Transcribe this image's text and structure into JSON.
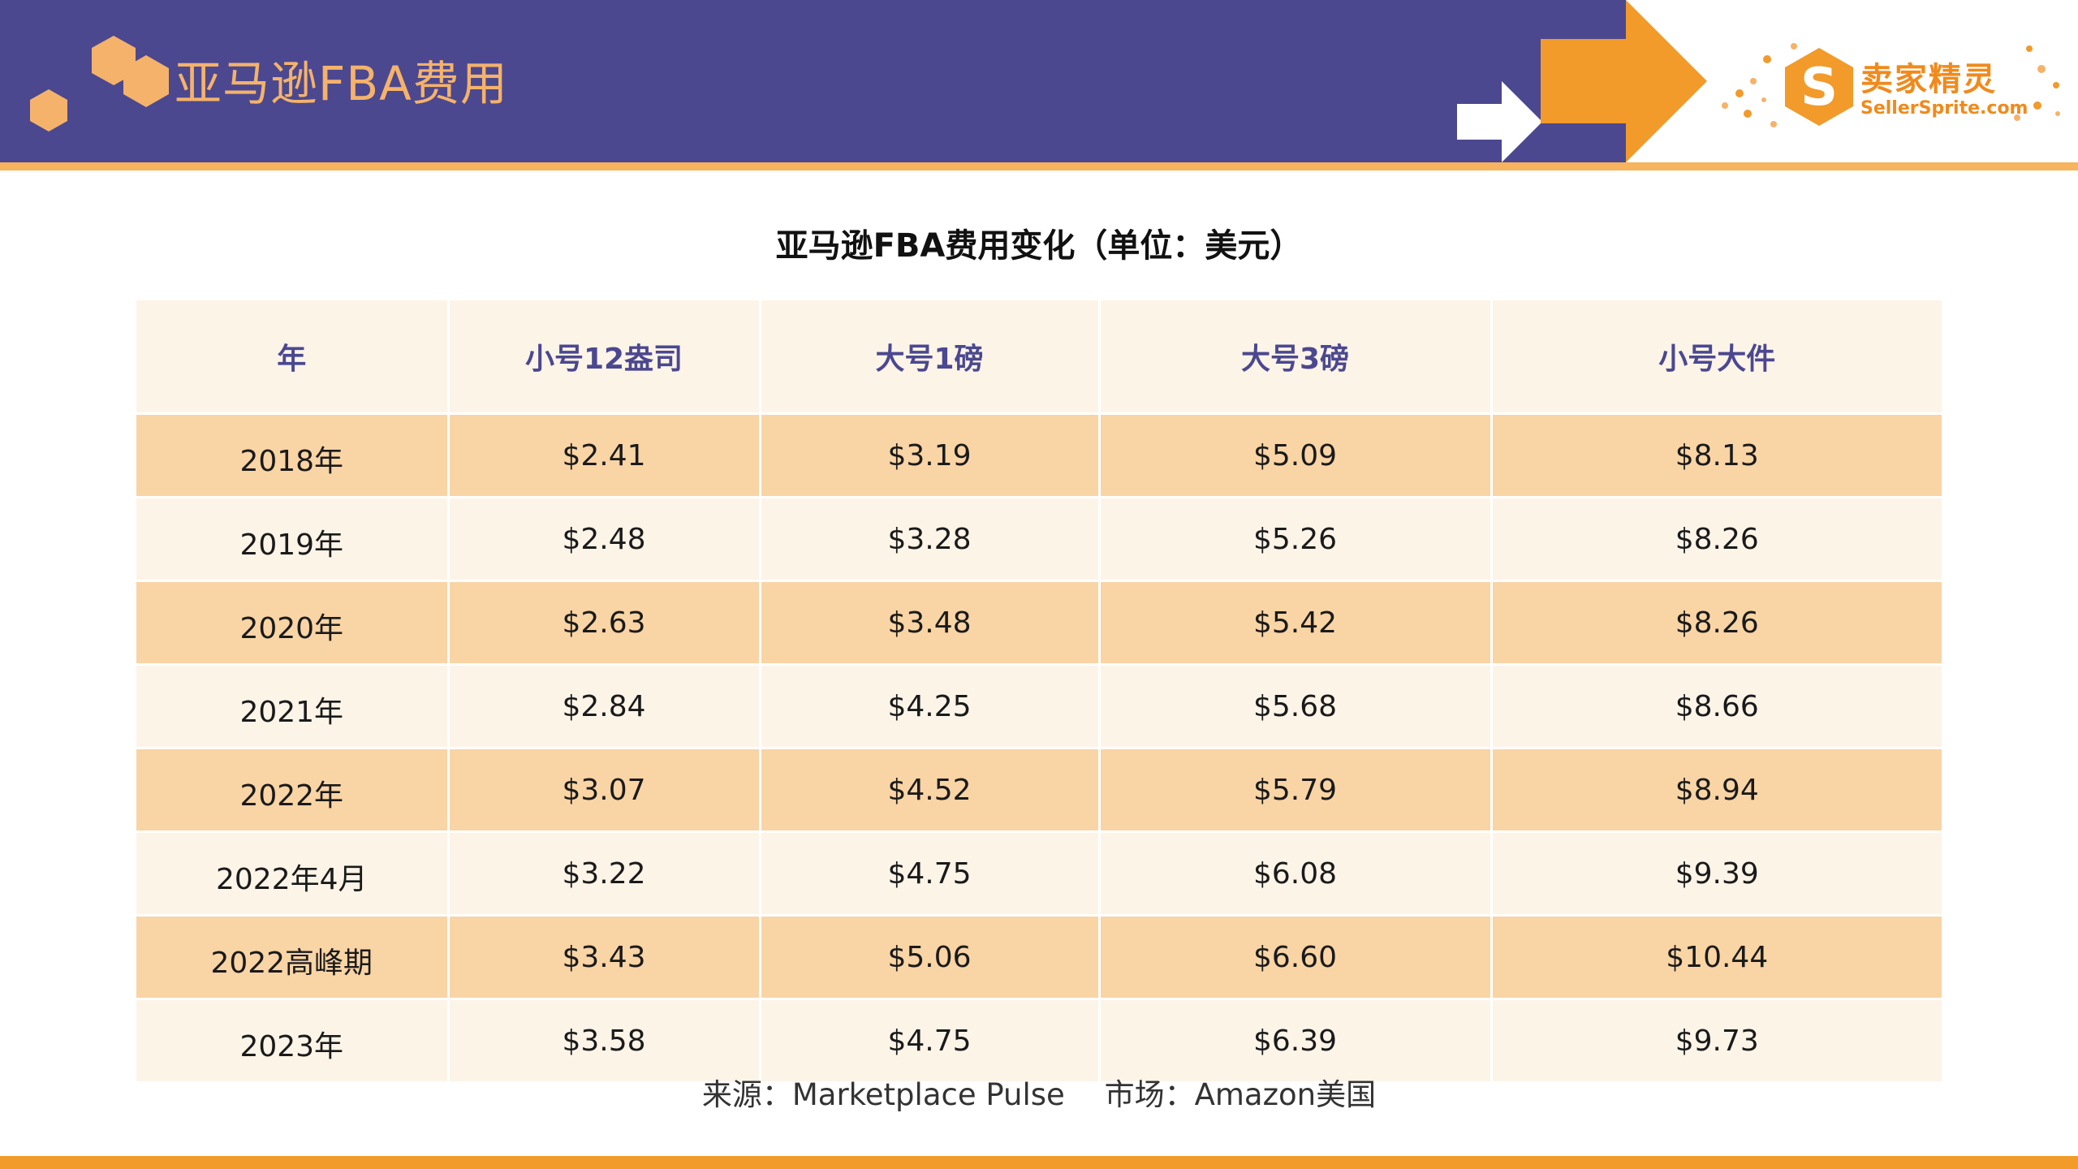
{
  "header": {
    "title": "亚马逊FBA费用",
    "logo": {
      "cn": "卖家精灵",
      "en": "SellerSprite.com",
      "mark": "S"
    }
  },
  "table": {
    "title": "亚马逊FBA费用变化（单位：美元）",
    "headers": [
      "年",
      "小号12盎司",
      "大号1磅",
      "大号3磅",
      "小号大件"
    ],
    "rows": [
      [
        "2018年",
        "$2.41",
        "$3.19",
        "$5.09",
        "$8.13"
      ],
      [
        "2019年",
        "$2.48",
        "$3.28",
        "$5.26",
        "$8.26"
      ],
      [
        "2020年",
        "$2.63",
        "$3.48",
        "$5.42",
        "$8.26"
      ],
      [
        "2021年",
        "$2.84",
        "$4.25",
        "$5.68",
        "$8.66"
      ],
      [
        "2022年",
        "$3.07",
        "$4.52",
        "$5.79",
        "$8.94"
      ],
      [
        "2022年4月",
        "$3.22",
        "$4.75",
        "$6.08",
        "$9.39"
      ],
      [
        "2022高峰期",
        "$3.43",
        "$5.06",
        "$6.60",
        "$10.44"
      ],
      [
        "2023年",
        "$3.58",
        "$4.75",
        "$6.39",
        "$9.73"
      ]
    ]
  },
  "source": "来源：Marketplace Pulse　 市场：Amazon美国",
  "colors": {
    "header_bg": "#4b4890",
    "accent_orange": "#f29a2a",
    "row_odd": "#f9d4a5",
    "row_even": "#fdf4e8"
  }
}
